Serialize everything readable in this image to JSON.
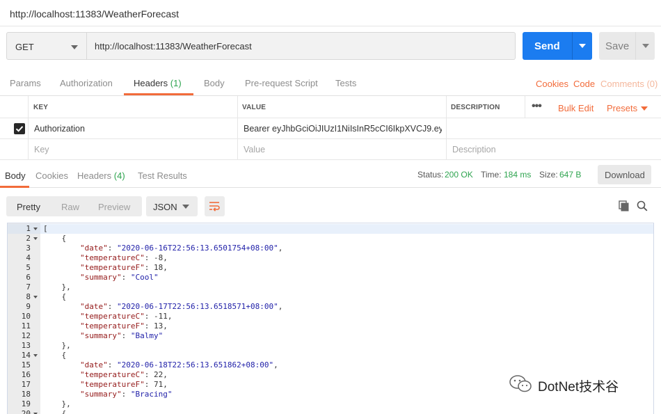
{
  "window": {
    "title": "http://localhost:11383/WeatherForecast"
  },
  "request": {
    "method": "GET",
    "url": "http://localhost:11383/WeatherForecast",
    "send_label": "Send",
    "save_label": "Save"
  },
  "request_tabs": {
    "params": "Params",
    "authorization": "Authorization",
    "headers": "Headers",
    "headers_count": "(1)",
    "body": "Body",
    "pre_request": "Pre-request Script",
    "tests": "Tests",
    "cookies": "Cookies",
    "code": "Code",
    "comments": "Comments (0)"
  },
  "headers_table": {
    "col_key": "KEY",
    "col_value": "VALUE",
    "col_description": "DESCRIPTION",
    "bulk_edit": "Bulk Edit",
    "presets": "Presets",
    "rows": [
      {
        "key": "Authorization",
        "value": "Bearer eyJhbGciOiJIUzI1NiIsInR5cCI6IkpXVCJ9.eyJ...",
        "description": ""
      }
    ],
    "placeholder_key": "Key",
    "placeholder_value": "Value",
    "placeholder_description": "Description"
  },
  "response_tabs": {
    "body": "Body",
    "cookies": "Cookies",
    "headers": "Headers",
    "headers_count": "(4)",
    "test_results": "Test Results"
  },
  "response_status": {
    "status_label": "Status:",
    "status_value": "200 OK",
    "time_label": "Time:",
    "time_value": "184 ms",
    "size_label": "Size:",
    "size_value": "647 B",
    "download_label": "Download"
  },
  "body_view": {
    "pretty": "Pretty",
    "raw": "Raw",
    "preview": "Preview",
    "format": "JSON"
  },
  "code_lines": [
    {
      "n": "1",
      "fold": true,
      "tokens": [
        {
          "t": "[",
          "c": "n"
        }
      ]
    },
    {
      "n": "2",
      "fold": true,
      "tokens": [
        {
          "t": "    {",
          "c": "n"
        }
      ]
    },
    {
      "n": "3",
      "fold": false,
      "tokens": [
        {
          "t": "        ",
          "c": "n"
        },
        {
          "t": "\"date\"",
          "c": "k"
        },
        {
          "t": ": ",
          "c": "n"
        },
        {
          "t": "\"2020-06-16T22:56:13.6501754+08:00\"",
          "c": "s"
        },
        {
          "t": ",",
          "c": "n"
        }
      ]
    },
    {
      "n": "4",
      "fold": false,
      "tokens": [
        {
          "t": "        ",
          "c": "n"
        },
        {
          "t": "\"temperatureC\"",
          "c": "k"
        },
        {
          "t": ": -8,",
          "c": "n"
        }
      ]
    },
    {
      "n": "5",
      "fold": false,
      "tokens": [
        {
          "t": "        ",
          "c": "n"
        },
        {
          "t": "\"temperatureF\"",
          "c": "k"
        },
        {
          "t": ": 18,",
          "c": "n"
        }
      ]
    },
    {
      "n": "6",
      "fold": false,
      "tokens": [
        {
          "t": "        ",
          "c": "n"
        },
        {
          "t": "\"summary\"",
          "c": "k"
        },
        {
          "t": ": ",
          "c": "n"
        },
        {
          "t": "\"Cool\"",
          "c": "s"
        }
      ]
    },
    {
      "n": "7",
      "fold": false,
      "tokens": [
        {
          "t": "    },",
          "c": "n"
        }
      ]
    },
    {
      "n": "8",
      "fold": true,
      "tokens": [
        {
          "t": "    {",
          "c": "n"
        }
      ]
    },
    {
      "n": "9",
      "fold": false,
      "tokens": [
        {
          "t": "        ",
          "c": "n"
        },
        {
          "t": "\"date\"",
          "c": "k"
        },
        {
          "t": ": ",
          "c": "n"
        },
        {
          "t": "\"2020-06-17T22:56:13.6518571+08:00\"",
          "c": "s"
        },
        {
          "t": ",",
          "c": "n"
        }
      ]
    },
    {
      "n": "10",
      "fold": false,
      "tokens": [
        {
          "t": "        ",
          "c": "n"
        },
        {
          "t": "\"temperatureC\"",
          "c": "k"
        },
        {
          "t": ": -11,",
          "c": "n"
        }
      ]
    },
    {
      "n": "11",
      "fold": false,
      "tokens": [
        {
          "t": "        ",
          "c": "n"
        },
        {
          "t": "\"temperatureF\"",
          "c": "k"
        },
        {
          "t": ": 13,",
          "c": "n"
        }
      ]
    },
    {
      "n": "12",
      "fold": false,
      "tokens": [
        {
          "t": "        ",
          "c": "n"
        },
        {
          "t": "\"summary\"",
          "c": "k"
        },
        {
          "t": ": ",
          "c": "n"
        },
        {
          "t": "\"Balmy\"",
          "c": "s"
        }
      ]
    },
    {
      "n": "13",
      "fold": false,
      "tokens": [
        {
          "t": "    },",
          "c": "n"
        }
      ]
    },
    {
      "n": "14",
      "fold": true,
      "tokens": [
        {
          "t": "    {",
          "c": "n"
        }
      ]
    },
    {
      "n": "15",
      "fold": false,
      "tokens": [
        {
          "t": "        ",
          "c": "n"
        },
        {
          "t": "\"date\"",
          "c": "k"
        },
        {
          "t": ": ",
          "c": "n"
        },
        {
          "t": "\"2020-06-18T22:56:13.651862+08:00\"",
          "c": "s"
        },
        {
          "t": ",",
          "c": "n"
        }
      ]
    },
    {
      "n": "16",
      "fold": false,
      "tokens": [
        {
          "t": "        ",
          "c": "n"
        },
        {
          "t": "\"temperatureC\"",
          "c": "k"
        },
        {
          "t": ": 22,",
          "c": "n"
        }
      ]
    },
    {
      "n": "17",
      "fold": false,
      "tokens": [
        {
          "t": "        ",
          "c": "n"
        },
        {
          "t": "\"temperatureF\"",
          "c": "k"
        },
        {
          "t": ": 71,",
          "c": "n"
        }
      ]
    },
    {
      "n": "18",
      "fold": false,
      "tokens": [
        {
          "t": "        ",
          "c": "n"
        },
        {
          "t": "\"summary\"",
          "c": "k"
        },
        {
          "t": ": ",
          "c": "n"
        },
        {
          "t": "\"Bracing\"",
          "c": "s"
        }
      ]
    },
    {
      "n": "19",
      "fold": false,
      "tokens": [
        {
          "t": "    },",
          "c": "n"
        }
      ]
    },
    {
      "n": "20",
      "fold": true,
      "tokens": [
        {
          "t": "    {",
          "c": "n"
        }
      ]
    }
  ],
  "watermark": {
    "text": "DotNet技术谷",
    "icon": "wechat-icon"
  },
  "colors": {
    "accent": "#f26b3a",
    "send": "#1b7cf0",
    "success": "#2ea44f"
  }
}
